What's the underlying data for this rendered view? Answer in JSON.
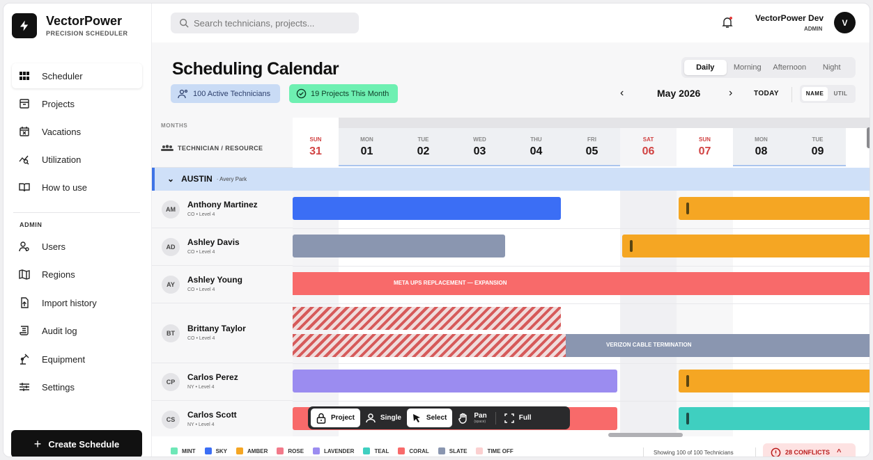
{
  "brand": {
    "title": "VectorPower",
    "subtitle": "PRECISION SCHEDULER"
  },
  "sidebar": {
    "items": [
      {
        "label": "Scheduler",
        "icon": "grid-icon",
        "active": true
      },
      {
        "label": "Projects",
        "icon": "archive-icon"
      },
      {
        "label": "Vacations",
        "icon": "calendar-x-icon"
      },
      {
        "label": "Utilization",
        "icon": "chart-search-icon"
      },
      {
        "label": "How to use",
        "icon": "book-icon"
      }
    ],
    "admin_label": "ADMIN",
    "admin_items": [
      {
        "label": "Users",
        "icon": "users-icon"
      },
      {
        "label": "Regions",
        "icon": "map-icon"
      },
      {
        "label": "Import history",
        "icon": "import-icon"
      },
      {
        "label": "Audit log",
        "icon": "scroll-icon"
      },
      {
        "label": "Equipment",
        "icon": "equipment-icon"
      },
      {
        "label": "Settings",
        "icon": "sliders-icon"
      }
    ],
    "create_label": "Create Schedule"
  },
  "topbar": {
    "search_placeholder": "Search technicians, projects...",
    "user_name": "VectorPower Dev",
    "user_role": "ADMIN",
    "avatar_letter": "V"
  },
  "page": {
    "title": "Scheduling Calendar",
    "shift_tabs": [
      "Daily",
      "Morning",
      "Afternoon",
      "Night"
    ],
    "active_shift": "Daily",
    "tech_chip": "100 Active Technicians",
    "project_chip": "19 Projects This Month",
    "prev": "‹",
    "month": "May 2026",
    "next": "›",
    "today": "TODAY",
    "view_name": "NAME",
    "view_util": "UTIL"
  },
  "grid": {
    "months_label": "MONTHS",
    "tech_header": "TECHNICIAN / RESOURCE",
    "days": [
      {
        "name": "SUN",
        "num": "31",
        "weekend": true
      },
      {
        "name": "MON",
        "num": "01",
        "weekend": false
      },
      {
        "name": "TUE",
        "num": "02",
        "weekend": false
      },
      {
        "name": "WED",
        "num": "03",
        "weekend": false
      },
      {
        "name": "THU",
        "num": "04",
        "weekend": false
      },
      {
        "name": "FRI",
        "num": "05",
        "weekend": false
      },
      {
        "name": "SAT",
        "num": "06",
        "weekend": true
      },
      {
        "name": "SUN",
        "num": "07",
        "weekend": true
      },
      {
        "name": "MON",
        "num": "08",
        "weekend": false
      },
      {
        "name": "TUE",
        "num": "09",
        "weekend": false
      }
    ],
    "region": {
      "name": "AUSTIN",
      "sub": "· Avery Park"
    },
    "technicians": [
      {
        "initials": "AM",
        "name": "Anthony Martinez",
        "sub": "CO • Level 4"
      },
      {
        "initials": "AD",
        "name": "Ashley Davis",
        "sub": "CO • Level 4"
      },
      {
        "initials": "AY",
        "name": "Ashley Young",
        "sub": "CO • Level 4"
      },
      {
        "initials": "BT",
        "name": "Brittany Taylor",
        "sub": "CO • Level 4"
      },
      {
        "initials": "CP",
        "name": "Carlos Perez",
        "sub": "NY • Level 4"
      },
      {
        "initials": "CS",
        "name": "Carlos Scott",
        "sub": "NY • Level 4"
      }
    ],
    "bar_labels": {
      "meta": "META UPS REPLACEMENT — EXPANSION",
      "verizon": "VERIZON CABLE TERMINATION"
    }
  },
  "toolbar": {
    "project": "Project",
    "single": "Single",
    "select": "Select",
    "pan": "Pan",
    "pan_hint": "(space)",
    "full": "Full"
  },
  "legend": [
    {
      "label": "MINT",
      "color": "#6ee7b7"
    },
    {
      "label": "SKY",
      "color": "#3b6ef5"
    },
    {
      "label": "AMBER",
      "color": "#f5a623"
    },
    {
      "label": "ROSE",
      "color": "#f27a8a"
    },
    {
      "label": "LAVENDER",
      "color": "#9b8cf0"
    },
    {
      "label": "TEAL",
      "color": "#3fcfc0"
    },
    {
      "label": "CORAL",
      "color": "#f86a6a"
    },
    {
      "label": "SLATE",
      "color": "#8a96b0"
    },
    {
      "label": "TIME OFF",
      "color": "#fbd0d0"
    }
  ],
  "footer": {
    "showing": "Showing 100 of 100 Technicians",
    "conflicts": "28 CONFLICTS",
    "conflict_chevron": "^"
  }
}
